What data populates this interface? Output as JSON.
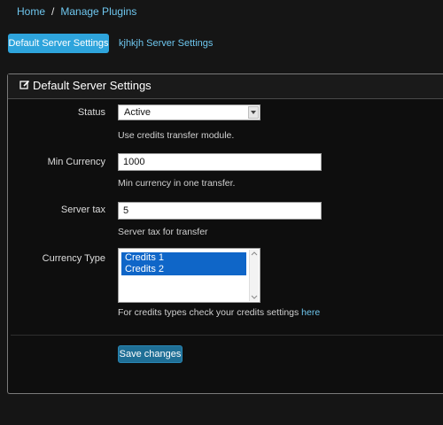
{
  "breadcrumb": {
    "home": "Home",
    "separator": "/",
    "current": "Manage Plugins"
  },
  "tabs": {
    "active": "Default Server Settings",
    "other": "kjhkjh Server Settings"
  },
  "panel": {
    "title": "Default Server Settings",
    "icon": "edit-icon"
  },
  "form": {
    "status": {
      "label": "Status",
      "value": "Active",
      "help": "Use credits transfer module."
    },
    "min_currency": {
      "label": "Min Currency",
      "value": "1000",
      "help": "Min currency in one transfer."
    },
    "server_tax": {
      "label": "Server tax",
      "value": "5",
      "help": "Server tax for transfer"
    },
    "currency_type": {
      "label": "Currency Type",
      "options": [
        "Credits 1",
        "Credits 2"
      ],
      "help_prefix": "For credits types check your credits settings",
      "help_link": "here"
    },
    "save_label": "Save changes"
  },
  "colors": {
    "accent": "#2ea4dc",
    "link": "#6ec6ee",
    "selection": "#0f66c8",
    "button": "#1f6f96"
  }
}
